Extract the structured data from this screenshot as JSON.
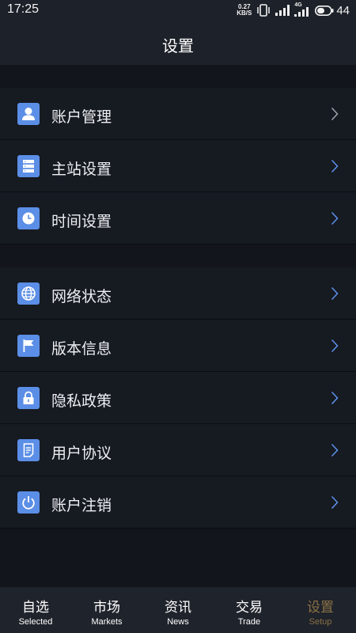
{
  "status_bar": {
    "time": "17:25",
    "net_speed_value": "0.27",
    "net_speed_unit": "KB/S",
    "network_type": "4G",
    "battery": "44"
  },
  "header": {
    "title": "设置"
  },
  "groups": [
    {
      "items": [
        {
          "label": "账户管理",
          "icon": "user-icon"
        },
        {
          "label": "主站设置",
          "icon": "server-icon"
        },
        {
          "label": "时间设置",
          "icon": "clock-icon"
        }
      ]
    },
    {
      "items": [
        {
          "label": "网络状态",
          "icon": "globe-icon"
        },
        {
          "label": "版本信息",
          "icon": "flag-icon"
        },
        {
          "label": "隐私政策",
          "icon": "lock-icon"
        },
        {
          "label": "用户协议",
          "icon": "document-icon"
        },
        {
          "label": "账户注销",
          "icon": "power-icon"
        }
      ]
    }
  ],
  "bottom_nav": [
    {
      "label": "自选",
      "sub": "Selected"
    },
    {
      "label": "市场",
      "sub": "Markets"
    },
    {
      "label": "资讯",
      "sub": "News"
    },
    {
      "label": "交易",
      "sub": "Trade"
    },
    {
      "label": "设置",
      "sub": "Setup",
      "active": true
    }
  ],
  "colors": {
    "accent_icon": "#5b8ee6",
    "active_tab": "#8a7145",
    "chevron_first": "#9aa0a8",
    "chevron": "#5b8ee6"
  }
}
